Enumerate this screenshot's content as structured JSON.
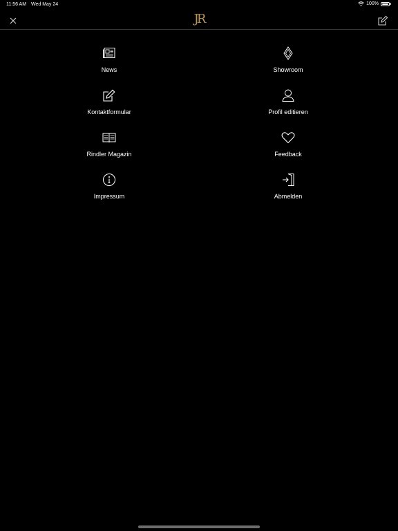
{
  "status_bar": {
    "time": "11:56 AM",
    "date": "Wed May 24",
    "battery": "100%",
    "battery_level": 1.0
  },
  "navbar": {
    "logo_text": "JR",
    "logo_color": "#b8935a",
    "close_icon": "close-icon",
    "edit_icon": "edit-icon"
  },
  "menu": {
    "items": [
      {
        "label": "News",
        "icon": "newspaper-icon"
      },
      {
        "label": "Showroom",
        "icon": "diamond-icon"
      },
      {
        "label": "Kontaktformular",
        "icon": "pencil-note-icon"
      },
      {
        "label": "Profil editieren",
        "icon": "user-icon"
      },
      {
        "label": "Rindler Magazin",
        "icon": "magazine-icon"
      },
      {
        "label": "Feedback",
        "icon": "heart-icon"
      },
      {
        "label": "Impressum",
        "icon": "info-icon"
      },
      {
        "label": "Abmelden",
        "icon": "logout-icon"
      }
    ]
  }
}
